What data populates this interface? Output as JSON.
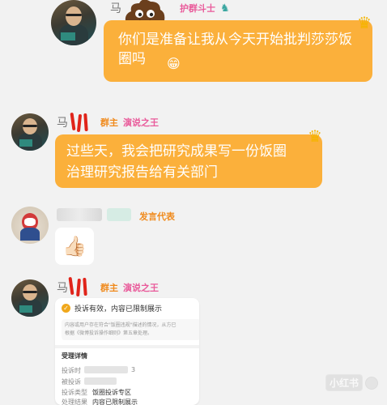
{
  "messages": [
    {
      "sender": "马",
      "badges": [
        "护群斗士"
      ],
      "text": "你们是准备让我从今天开始批判莎莎饭圈吗"
    },
    {
      "sender": "马",
      "badges": [
        "群主",
        "演说之王"
      ],
      "text_line1": "过些天，我会把研究成果写一份饭圈",
      "text_line2": "治理研究报告给有关部门"
    },
    {
      "sender": "",
      "badges": [
        "发言代表"
      ],
      "emoji": "👍🏻"
    },
    {
      "sender": "马",
      "badges": [
        "群主",
        "演说之王"
      ],
      "card": {
        "status": "投诉有效，内容已限制展示",
        "desc_line1": "内容或用户存在符合\"饭圈违规\"描述的情况，从方已",
        "desc_line2": "根据《微博投诉操作细则》第五章处理。",
        "section_title": "受理详情",
        "rows": [
          {
            "label": "投诉时",
            "value": "3"
          },
          {
            "label": "被投诉",
            "value": ""
          },
          {
            "label": "投诉类型",
            "value": "饭圈投诉专区"
          },
          {
            "label": "处理结果",
            "value": "内容已限制展示"
          }
        ]
      }
    }
  ],
  "watermark": "小红书"
}
